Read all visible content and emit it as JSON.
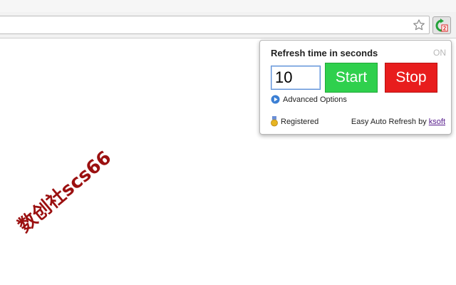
{
  "popup": {
    "title": "Refresh time in seconds",
    "status": "ON",
    "seconds_value": "10",
    "start_label": "Start",
    "stop_label": "Stop",
    "advanced_label": "Advanced Options",
    "registered_label": "Registered",
    "credit_text": "Easy Auto Refresh by ",
    "credit_link": "ksoft",
    "start_color": "#2fd04d",
    "stop_color": "#e81d1d"
  },
  "browser": {
    "extension_badge": "2",
    "icons": [
      "star-icon",
      "easy-auto-refresh-icon"
    ]
  },
  "watermark": {
    "text": "数创社scs66",
    "color": "#9b1010"
  }
}
